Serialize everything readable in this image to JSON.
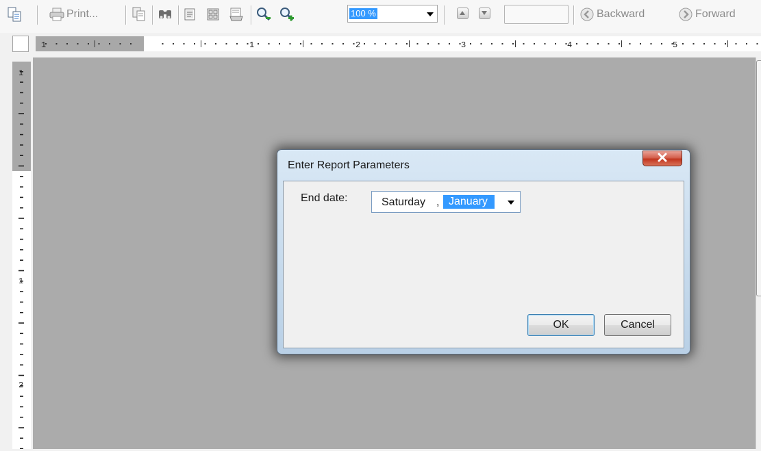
{
  "toolbar": {
    "print_label": "Print...",
    "zoom": {
      "value": "100 %"
    },
    "page_input": {
      "value": ""
    },
    "backward_label": "Backward",
    "forward_label": "Forward",
    "icons": [
      "document-map-icon",
      "print-icon",
      "copy-icon",
      "find-icon",
      "page-setup-icon",
      "multiple-pages-icon",
      "export-icon",
      "zoom-out-icon",
      "zoom-in-icon",
      "previous-page-icon",
      "next-page-icon",
      "backward-icon",
      "forward-icon"
    ]
  },
  "rulers": {
    "horizontal_labels": [
      "1",
      "1",
      "2",
      "3",
      "4",
      "5"
    ],
    "vertical_labels": [
      "1",
      "1",
      "2"
    ]
  },
  "dialog": {
    "title": "Enter Report Parameters",
    "close_icon": "close-icon",
    "end_date_label": "End date:",
    "day_value": "Saturday",
    "separator": ",",
    "month_value": "January",
    "ok_label": "OK",
    "cancel_label": "Cancel"
  },
  "colors": {
    "canvas": "#ababab",
    "selection": "#3399ff",
    "close_button": "#c2361f"
  }
}
